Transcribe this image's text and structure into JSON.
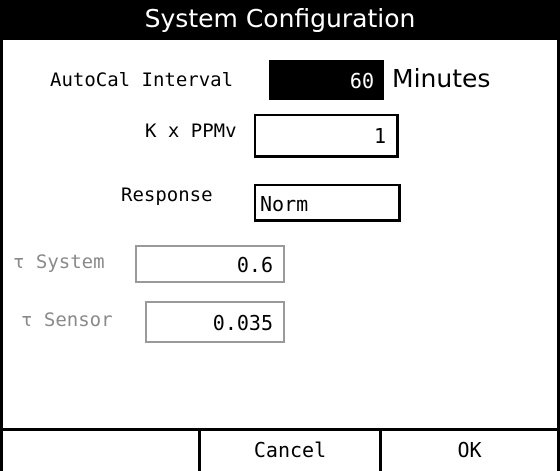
{
  "title": "System Configuration",
  "fields": {
    "autocal": {
      "label": "AutoCal Interval",
      "value": "60",
      "unit": "Minutes"
    },
    "kppmv": {
      "label": "K x PPMv",
      "value": "1"
    },
    "response": {
      "label": "Response",
      "value": "Norm"
    },
    "tau_system": {
      "label": "τ System",
      "value": "0.6"
    },
    "tau_sensor": {
      "label": "τ Sensor",
      "value": "0.035"
    }
  },
  "buttons": {
    "cancel": "Cancel",
    "ok": "OK"
  }
}
